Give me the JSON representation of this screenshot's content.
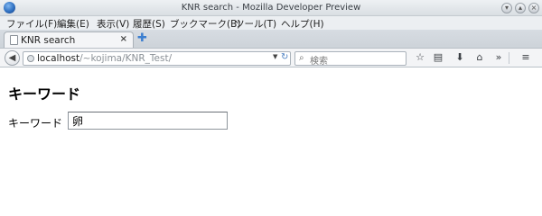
{
  "window": {
    "title": "KNR search - Mozilla Developer Preview"
  },
  "menu": {
    "items": [
      "ファイル(F)",
      "編集(E)",
      "表示(V)",
      "履歴(S)",
      "ブックマーク(B)",
      "ツール(T)",
      "ヘルプ(H)"
    ]
  },
  "tab": {
    "label": "KNR search",
    "close": "×",
    "new_tab": "✚"
  },
  "navbar": {
    "url_host": "localhost",
    "url_path": "/~kojima/KNR_Test/",
    "search_placeholder": "検索"
  },
  "page": {
    "heading": "キーワード",
    "keyword_label": "キーワード",
    "keyword_value": "卵"
  }
}
